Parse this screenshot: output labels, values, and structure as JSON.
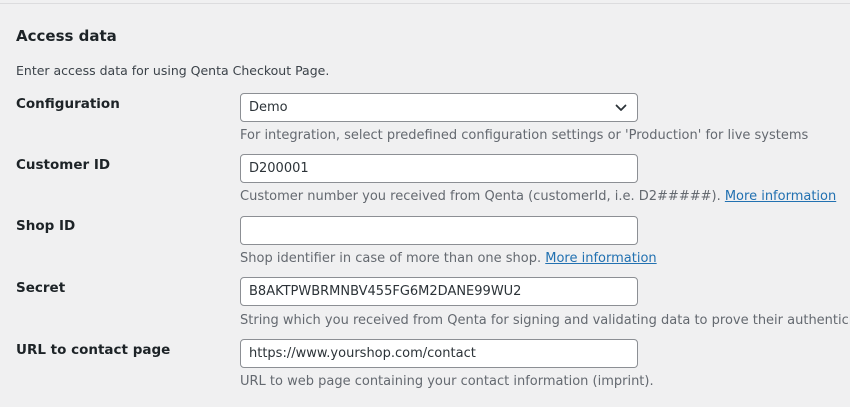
{
  "section": {
    "title": "Access data",
    "description": "Enter access data for using Qenta Checkout Page."
  },
  "fields": {
    "configuration": {
      "label": "Configuration",
      "value": "Demo",
      "help": "For integration, select predefined configuration settings or 'Production' for live systems"
    },
    "customer_id": {
      "label": "Customer ID",
      "value": "D200001",
      "help": "Customer number you received from Qenta (customerId, i.e. D2#####).",
      "link": "More information"
    },
    "shop_id": {
      "label": "Shop ID",
      "value": "",
      "help": "Shop identifier in case of more than one shop.",
      "link": "More information"
    },
    "secret": {
      "label": "Secret",
      "value": "B8AKTPWBRMNBV455FG6M2DANE99WU2",
      "help": "String which you received from Qenta for signing and validating data to prove their authenticity."
    },
    "contact_url": {
      "label": "URL to contact page",
      "value": "https://www.yourshop.com/contact",
      "help": "URL to web page containing your contact information (imprint)."
    }
  },
  "icons": {
    "select_arrow": "chevron-down-icon"
  },
  "colors": {
    "background": "#f0f0f1",
    "link": "#2271b1",
    "help_text": "#646970",
    "input_border": "#8c8f94"
  }
}
